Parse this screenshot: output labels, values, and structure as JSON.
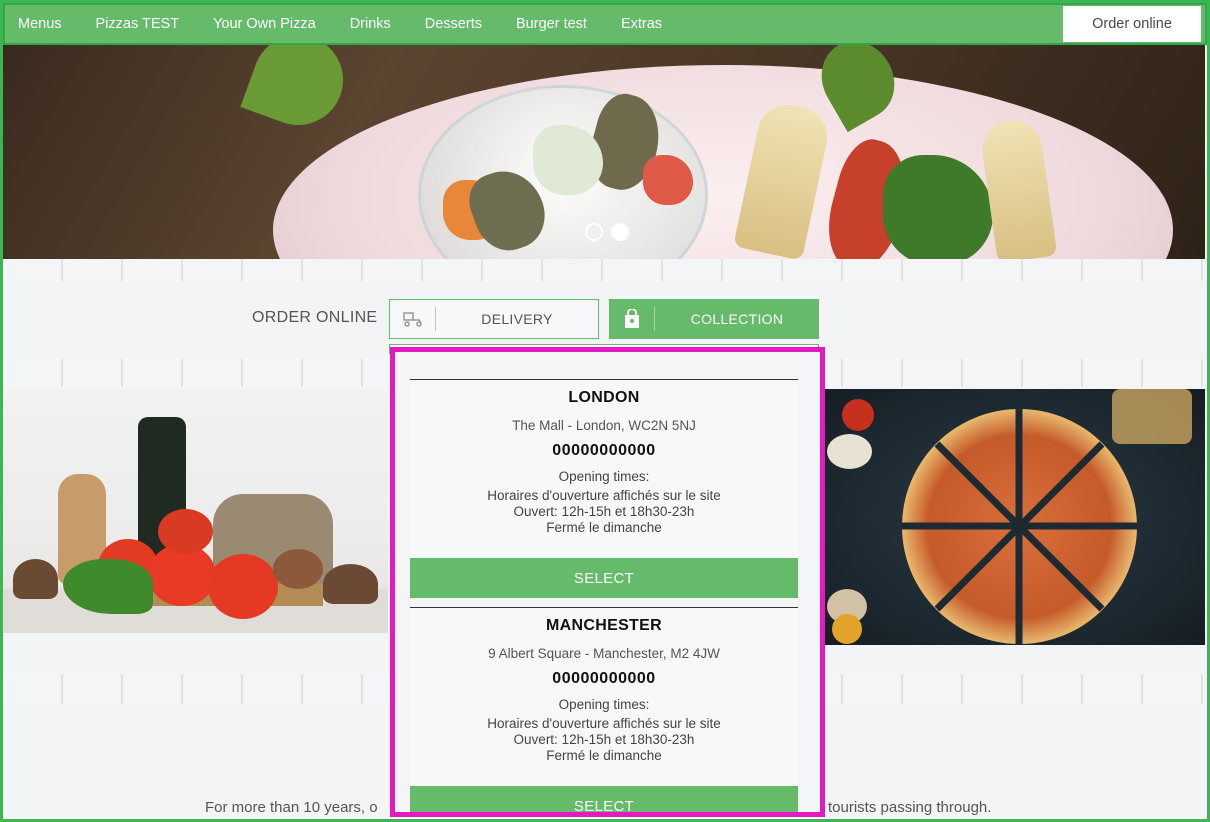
{
  "nav": {
    "items": [
      "Menus",
      "Pizzas TEST",
      "Your Own Pizza",
      "Drinks",
      "Desserts",
      "Burger test",
      "Extras"
    ],
    "order_online": "Order online"
  },
  "hero": {
    "slides": 2,
    "active_slide": 2
  },
  "order": {
    "label": "ORDER ONLINE",
    "delivery": "DELIVERY",
    "collection": "COLLECTION",
    "delivery_icon": "scooter-icon",
    "collection_icon": "shopping-bag-icon"
  },
  "locations": [
    {
      "name": "LONDON",
      "address": "The Mall - London, WC2N 5NJ",
      "phone": "00000000000",
      "opening_title": "Opening times:",
      "opening_lines": [
        "Horaires d'ouverture affichés sur le site",
        "Ouvert: 12h-15h et 18h30-23h",
        "Fermé le dimanche"
      ],
      "select": "SELECT"
    },
    {
      "name": "MANCHESTER",
      "address": "9 Albert Square - Manchester, M2 4JW",
      "phone": "00000000000",
      "opening_title": "Opening times:",
      "opening_lines": [
        "Horaires d'ouverture affichés sur le site",
        "Ouvert: 12h-15h et 18h30-23h",
        "Fermé le dimanche"
      ],
      "select": "SELECT"
    }
  ],
  "about": {
    "left_text": "For more than 10 years, o",
    "right_text": "tourists passing through."
  },
  "colors": {
    "accent": "#66bb6a",
    "highlight": "#e419c2"
  }
}
